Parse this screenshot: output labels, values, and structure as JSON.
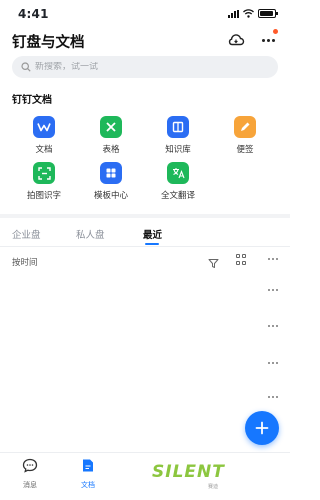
{
  "status_bar": {
    "time": "4:41"
  },
  "header": {
    "title": "钉盘与文档"
  },
  "search": {
    "placeholder": "新搜索，试一试"
  },
  "section": {
    "title": "钉钉文档"
  },
  "apps": [
    {
      "label": "文档",
      "icon": "document-icon",
      "color": "#2b6df3"
    },
    {
      "label": "表格",
      "icon": "sheet-icon",
      "color": "#1eb85a"
    },
    {
      "label": "知识库",
      "icon": "knowledge-base-icon",
      "color": "#2b6df3"
    },
    {
      "label": "便签",
      "icon": "note-icon",
      "color": "#f7a43a"
    },
    {
      "label": "拍图识字",
      "icon": "scan-text-icon",
      "color": "#1eb85a"
    },
    {
      "label": "模板中心",
      "icon": "template-icon",
      "color": "#2b6df3"
    },
    {
      "label": "全文翻译",
      "icon": "translate-icon",
      "color": "#1eb85a"
    }
  ],
  "tabs": [
    {
      "label": "企业盘"
    },
    {
      "label": "私人盘"
    },
    {
      "label": "最近"
    }
  ],
  "active_tab": "最近",
  "list": {
    "sort_label": "按时间"
  },
  "bottom_nav": [
    {
      "label": "消息",
      "icon": "message-icon"
    },
    {
      "label": "文档",
      "icon": "docs-icon"
    }
  ],
  "watermark": {
    "text": "SILENT",
    "sub": "赛迪"
  },
  "colors": {
    "accent": "#1677ff",
    "green": "#1eb85a",
    "orange": "#f7a43a",
    "badge": "#ff5a2a"
  }
}
